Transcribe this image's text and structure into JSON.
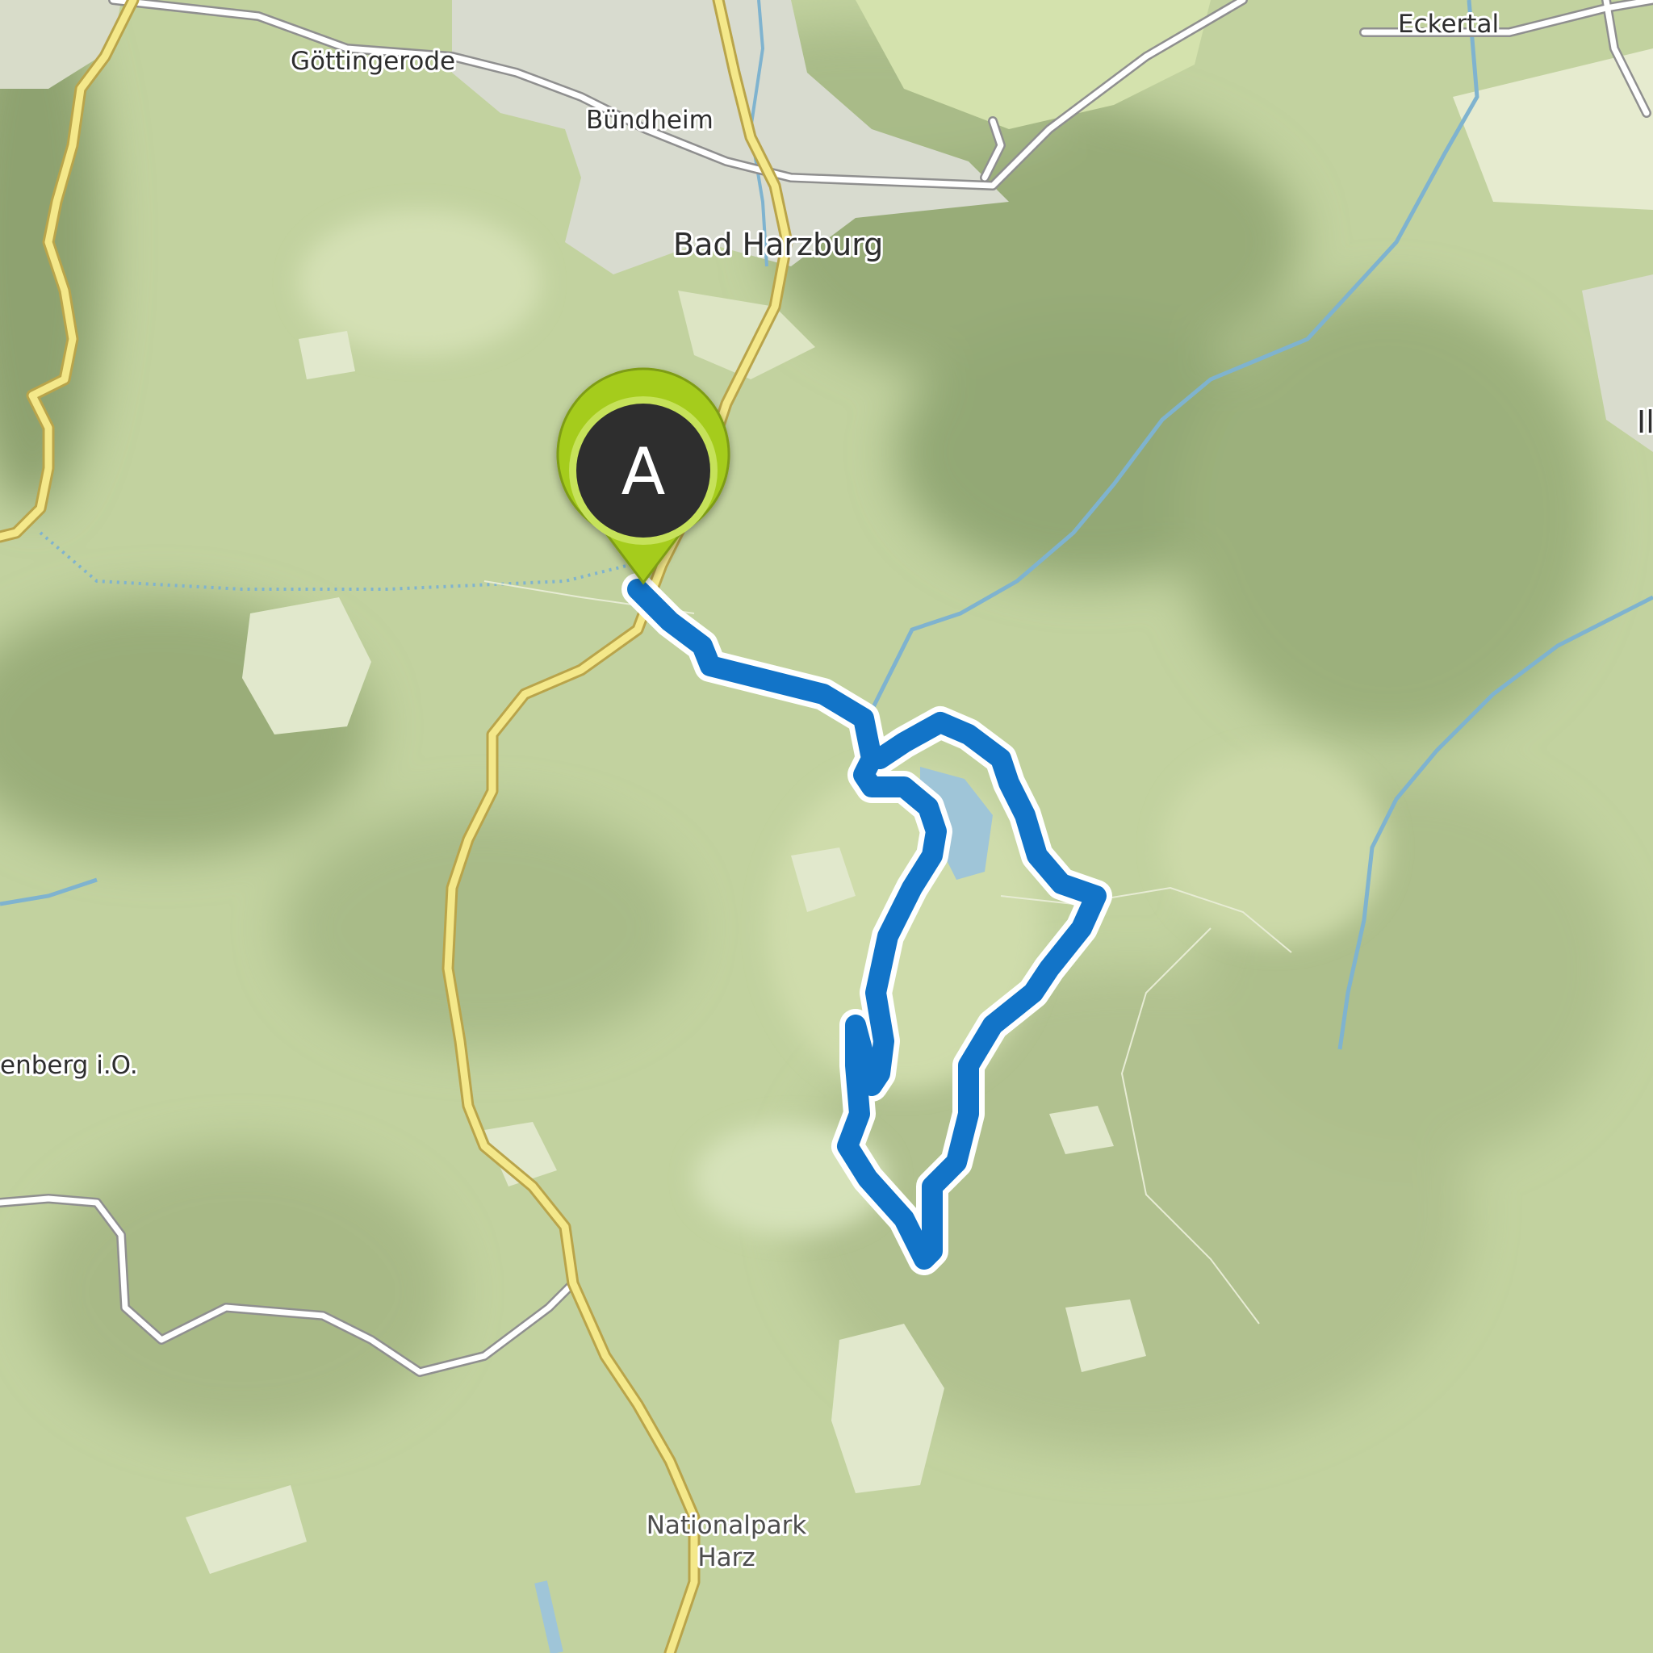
{
  "map": {
    "places": [
      {
        "id": "gottingerode",
        "label": "Göttingerode"
      },
      {
        "id": "bundheim",
        "label": "Bündheim"
      },
      {
        "id": "bad-harzburg",
        "label": "Bad Harzburg"
      },
      {
        "id": "eckertal",
        "label": "Eckertal"
      },
      {
        "id": "ilse",
        "label": "Ilse"
      },
      {
        "id": "enberg",
        "label": "enberg i.O."
      },
      {
        "id": "nationalpark-line1",
        "label": "Nationalpark"
      },
      {
        "id": "nationalpark-line2",
        "label": "Harz"
      }
    ],
    "start_marker": {
      "label": "A",
      "fill": "#2d2d2d",
      "ring": "#a5cc1c"
    },
    "route": {
      "color": "#0f74cc",
      "outline": "#ffffff"
    }
  }
}
